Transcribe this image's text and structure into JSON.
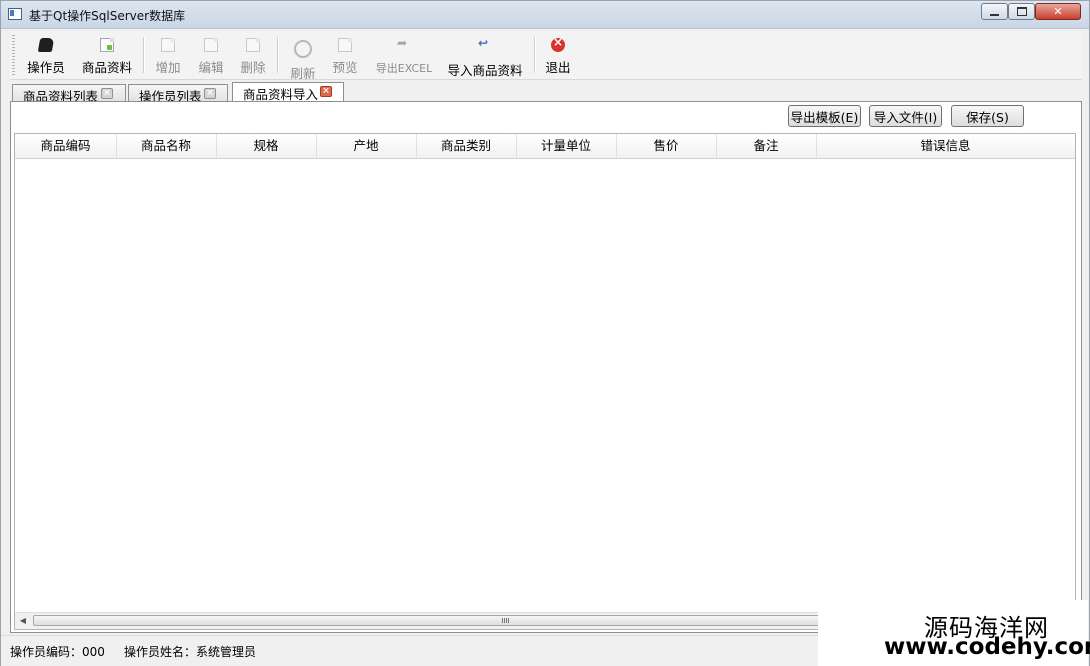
{
  "window": {
    "title": "基于Qt操作SqlServer数据库"
  },
  "toolbar": {
    "items": [
      {
        "label": "操作员",
        "icon": "operator-icon",
        "enabled": true
      },
      {
        "label": "商品资料",
        "icon": "product-doc-icon",
        "enabled": true
      },
      {
        "label": "增加",
        "icon": "add-doc-icon",
        "enabled": false
      },
      {
        "label": "编辑",
        "icon": "edit-doc-icon",
        "enabled": false
      },
      {
        "label": "删除",
        "icon": "delete-doc-icon",
        "enabled": false
      },
      {
        "label": "刷新",
        "icon": "refresh-icon",
        "enabled": false
      },
      {
        "label": "预览",
        "icon": "preview-doc-icon",
        "enabled": false
      },
      {
        "label": "导出EXCEL",
        "icon": "export-arrow-icon",
        "enabled": false
      },
      {
        "label": "导入商品资料",
        "icon": "import-arrow-icon",
        "enabled": true
      },
      {
        "label": "退出",
        "icon": "exit-icon",
        "enabled": true
      }
    ]
  },
  "tabs": [
    {
      "label": "商品资料列表",
      "active": false
    },
    {
      "label": "操作员列表",
      "active": false
    },
    {
      "label": "商品资料导入",
      "active": true
    }
  ],
  "actions": {
    "export_template": "导出模板(E)",
    "import_file": "导入文件(I)",
    "save": "保存(S)"
  },
  "table": {
    "columns": [
      "商品编码",
      "商品名称",
      "规格",
      "产地",
      "商品类别",
      "计量单位",
      "售价",
      "备注",
      "错误信息"
    ],
    "rows": []
  },
  "status": {
    "operator_code": "操作员编码：000",
    "operator_name": "操作员姓名：系统管理员"
  },
  "watermark": {
    "name": "源码海洋网",
    "url": "www.codehy.com"
  },
  "colors": {
    "accent_exit": "#d9342b",
    "tab_close_active": "#e06a4d",
    "title_close": "#c8402f"
  }
}
